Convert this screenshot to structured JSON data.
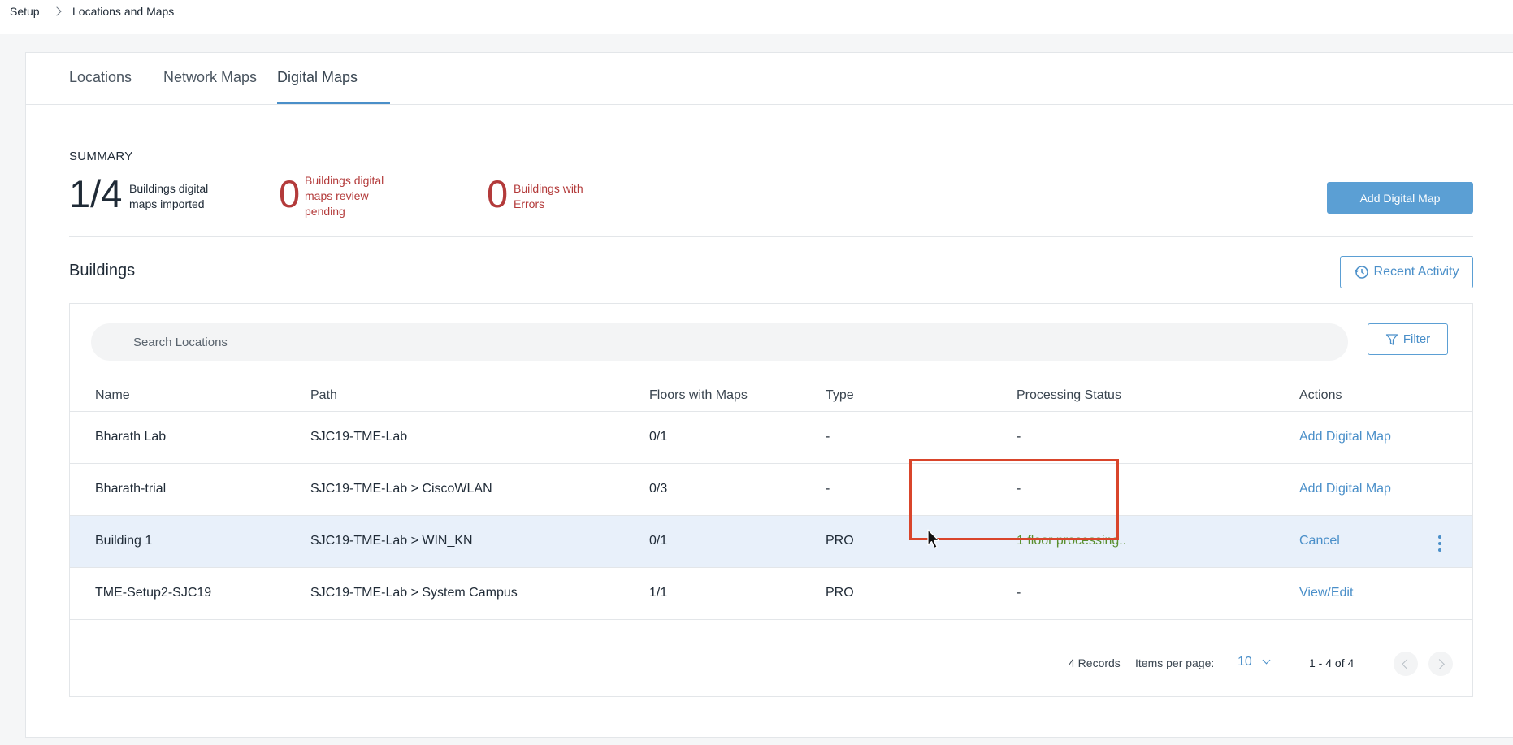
{
  "breadcrumb": {
    "root": "Setup",
    "current": "Locations and Maps"
  },
  "tabs": [
    {
      "label": "Locations",
      "active": false
    },
    {
      "label": "Network Maps",
      "active": false
    },
    {
      "label": "Digital Maps",
      "active": true
    }
  ],
  "summary": {
    "title": "SUMMARY",
    "stats": [
      {
        "value": "1/4",
        "label": "Buildings digital maps imported"
      },
      {
        "value": "0",
        "label": "Buildings digital maps review pending"
      },
      {
        "value": "0",
        "label": "Buildings with Errors"
      }
    ],
    "add_button": "Add Digital Map"
  },
  "buildings": {
    "title": "Buildings",
    "recent_activity": "Recent Activity",
    "search_placeholder": "Search Locations",
    "filter_label": "Filter",
    "columns": [
      "Name",
      "Path",
      "Floors with Maps",
      "Type",
      "Processing Status",
      "Actions"
    ],
    "rows": [
      {
        "name": "Bharath Lab",
        "path": "SJC19-TME-Lab",
        "floors": "0/1",
        "type": "-",
        "status": "-",
        "action": "Add Digital Map"
      },
      {
        "name": "Bharath-trial",
        "path": "SJC19-TME-Lab > CiscoWLAN",
        "floors": "0/3",
        "type": "-",
        "status": "-",
        "action": "Add Digital Map"
      },
      {
        "name": "Building 1",
        "path": "SJC19-TME-Lab > WIN_KN",
        "floors": "0/1",
        "type": "PRO",
        "status": "1 floor processing..",
        "action": "Cancel"
      },
      {
        "name": "TME-Setup2-SJC19",
        "path": "SJC19-TME-Lab > System Campus",
        "floors": "1/1",
        "type": "PRO",
        "status": "-",
        "action": "View/Edit"
      }
    ],
    "footer": {
      "records": "4 Records",
      "items_per_page_label": "Items per page:",
      "items_per_page": "10",
      "range": "1 - 4 of 4"
    }
  },
  "colors": {
    "accent": "#4a8fc9",
    "primary_button": "#5b9fd4",
    "error_text": "#b33a3a",
    "processing_text": "#5a8f2f",
    "highlight_row": "#e8f0fa",
    "annotation_box": "#d9452b"
  },
  "icons": [
    "chevron-right-icon",
    "history-icon",
    "filter-icon",
    "kebab-menu-icon",
    "chevron-down-icon",
    "chevron-left-icon",
    "mouse-cursor-icon"
  ]
}
